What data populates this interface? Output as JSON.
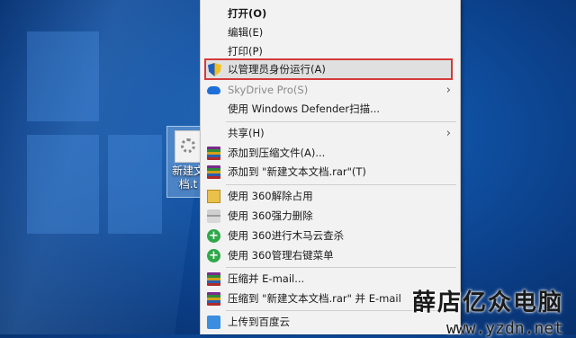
{
  "desktop": {
    "icon_label": "新建文本文档.txt",
    "icon_label_line1": "新建文",
    "icon_label_line2": "档.t"
  },
  "context_menu": {
    "items": [
      {
        "label": "打开(O)",
        "bold": true
      },
      {
        "label": "编辑(E)"
      },
      {
        "label": "打印(P)"
      },
      {
        "label": "以管理员身份运行(A)",
        "icon": "uac-shield-icon",
        "highlighted": true
      },
      {
        "label": "SkyDrive Pro(S)",
        "icon": "cloud-icon",
        "disabled": true,
        "submenu": true
      },
      {
        "label": "使用 Windows Defender扫描..."
      },
      {
        "label": "共享(H)",
        "submenu": true
      },
      {
        "label": "添加到压缩文件(A)...",
        "icon": "winrar-icon"
      },
      {
        "label": "添加到 \"新建文本文档.rar\"(T)",
        "icon": "winrar-icon"
      },
      {
        "label": "使用 360解除占用",
        "icon": "folder-unlock-icon"
      },
      {
        "label": "使用 360强力删除",
        "icon": "shredder-icon"
      },
      {
        "label": "使用 360进行木马云查杀",
        "icon": "360-plus-icon"
      },
      {
        "label": "使用 360管理右键菜单",
        "icon": "360-plus-icon"
      },
      {
        "label": "压缩并 E-mail...",
        "icon": "winrar-icon"
      },
      {
        "label": "压缩到 \"新建文本文档.rar\" 并 E-mail",
        "icon": "winrar-icon"
      },
      {
        "label": "上传到百度云",
        "icon": "baidu-cloud-icon"
      }
    ]
  },
  "watermark": {
    "title": "薛店亿众电脑",
    "url": "www.yzdn.net"
  },
  "colors": {
    "highlight_border": "#d43a3a",
    "menu_bg": "#f2f2f2",
    "desktop_blue": "#0f4fa0"
  }
}
